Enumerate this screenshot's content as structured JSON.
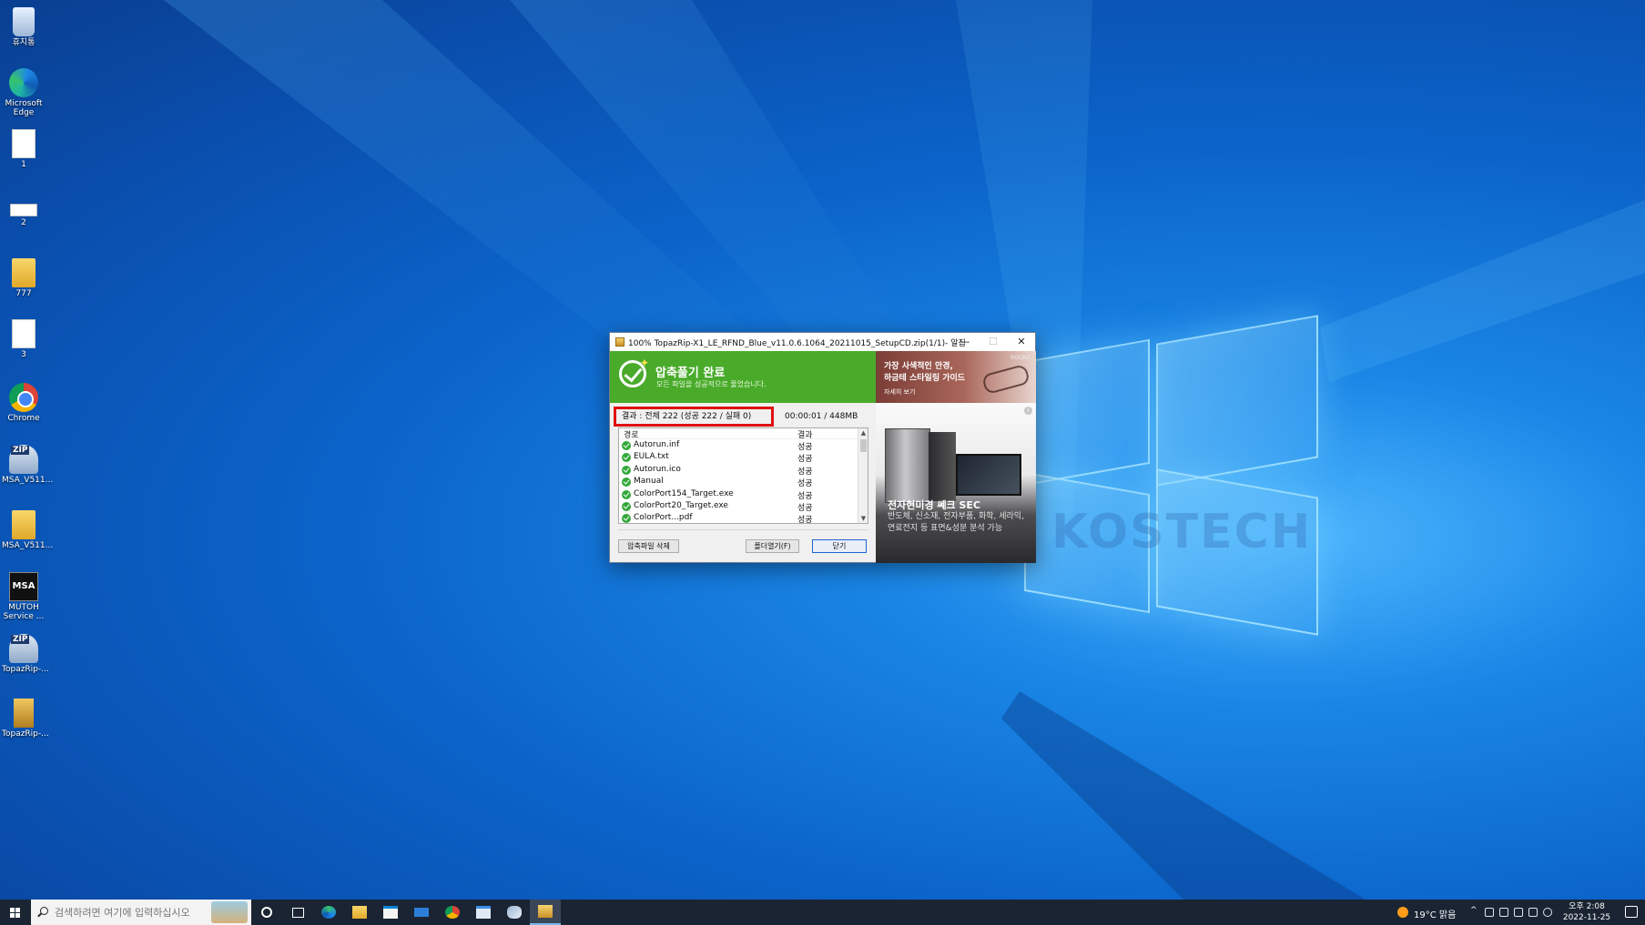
{
  "desktop": {
    "icons": [
      {
        "label": "휴지통",
        "icon": "recycle-bin-icon"
      },
      {
        "label": "Microsoft Edge",
        "icon": "edge-icon"
      },
      {
        "label": "1",
        "icon": "document-icon"
      },
      {
        "label": "2",
        "icon": "document-icon"
      },
      {
        "label": "777",
        "icon": "folder-icon"
      },
      {
        "label": "3",
        "icon": "document-icon"
      },
      {
        "label": "Chrome",
        "icon": "chrome-icon"
      },
      {
        "label": "MSA_V511...",
        "icon": "zip-icon"
      },
      {
        "label": "MSA_V511...",
        "icon": "folder-icon"
      },
      {
        "label": "MUTOH Service ...",
        "icon": "msa-app-icon"
      },
      {
        "label": "TopazRip-...",
        "icon": "zip-icon"
      },
      {
        "label": "TopazRip-...",
        "icon": "archive-icon"
      }
    ],
    "watermark": "KOSTECH"
  },
  "dialog": {
    "title": "100% TopazRip-X1_LE_RFND_Blue_v11.0.6.1064_20211015_SetupCD.zip(1/1)- 알집",
    "minimize": "—",
    "maximize": "☐",
    "close": "✕",
    "banner_title": "압축풀기 완료",
    "banner_subtitle": "모든 파일을 성공적으로 풀었습니다.",
    "ad_top": {
      "line1": "가장 사색적인 안경,",
      "line2": "하금테 스타일링 가이드",
      "line3": "자세히 보기",
      "brand": "ROUNZ"
    },
    "result": "결과 : 전체 222 (성공 222 / 실패 0)",
    "timing": "00:00:01 / 448MB",
    "columns": {
      "path": "경로",
      "result": "결과"
    },
    "files": [
      {
        "name": "Autorun.inf",
        "result": "성공"
      },
      {
        "name": "EULA.txt",
        "result": "성공"
      },
      {
        "name": "Autorun.ico",
        "result": "성공"
      },
      {
        "name": "Manual",
        "result": "성공"
      },
      {
        "name": "ColorPort154_Target.exe",
        "result": "성공"
      },
      {
        "name": "ColorPort20_Target.exe",
        "result": "성공"
      },
      {
        "name": "ColorPort...pdf",
        "result": "성공"
      }
    ],
    "buttons": {
      "delete_archive": "압축파일 삭제",
      "open_folder": "폴더열기(F)",
      "close": "닫기"
    },
    "ad_side": {
      "info": "i",
      "title": "전자현미경 쎄크 SEC",
      "body": "반도체, 신소재, 전자부품, 화학, 세라믹, 연료전지 등 표면&성분 분석 가능"
    }
  },
  "taskbar": {
    "search_placeholder": "검색하려면 여기에 입력하십시오",
    "weather": "19°C  맑음",
    "time": "오후 2:08",
    "date": "2022-11-25",
    "tray_chevron": "^"
  }
}
